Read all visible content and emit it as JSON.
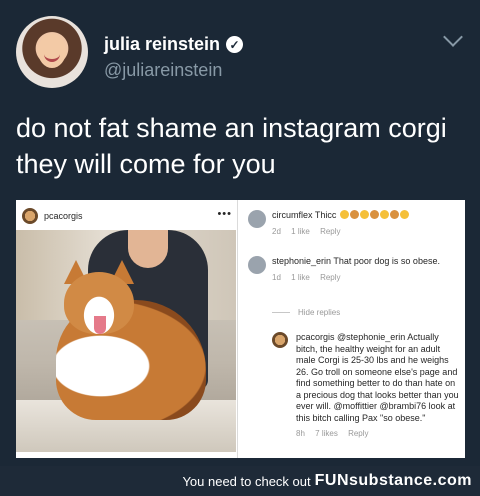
{
  "tweet": {
    "name": "julia reinstein",
    "handle": "@juliareinstein",
    "text": "do not fat shame an instagram corgi they will come for you"
  },
  "instagram": {
    "post_user": "pcacorgis",
    "more": "•••",
    "comments": [
      {
        "user": "circumflex",
        "text": "Thicc",
        "emojis": [
          "heart-eyes",
          "dog",
          "heart-eyes",
          "dog",
          "heart-eyes",
          "dog",
          "heart-eyes"
        ],
        "age": "2d",
        "likes": "1 like",
        "reply": "Reply"
      },
      {
        "user": "stephonie_erin",
        "text": "That poor dog is so obese.",
        "age": "1d",
        "likes": "1 like",
        "reply": "Reply"
      }
    ],
    "hide_replies": "Hide replies",
    "reply_comment": {
      "user": "pcacorgis",
      "text": "@stephonie_erin Actually bitch, the healthy weight for an adult male Corgi is 25-30 lbs and he weighs 26. Go troll on someone else's page and find something better to do than hate on a precious dog that looks better than you ever will. @moffittier @brambi76 look at this bitch calling Pax \"so obese.\"",
      "age": "8h",
      "likes": "7 likes",
      "reply": "Reply"
    }
  },
  "footer": {
    "text": "You need to check out",
    "brand": "FUNsubstance.com"
  },
  "colors": {
    "background": "#1b2836",
    "handle": "#8899a6",
    "meta": "#999999"
  }
}
